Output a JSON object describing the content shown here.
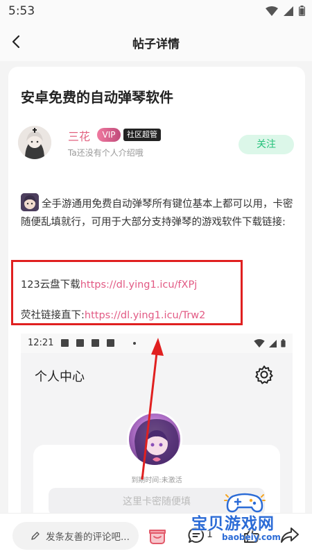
{
  "status_bar": {
    "time": "5:53"
  },
  "nav": {
    "title": "帖子详情"
  },
  "post": {
    "title": "安卓免费的自动弹琴软件",
    "author": {
      "name": "三花",
      "vip": "VIP",
      "role": "社区超管",
      "bio": "Ta还没有个人介绍哦"
    },
    "follow_label": "关注",
    "body": "全手游通用免费自动弹琴所有键位基本上都可以用，卡密随便乱填就行，可用于大部分支持弹琴的游戏软件下载链接:",
    "link1": {
      "label": "123云盘下载",
      "url": "https://dl.ying1.icu/fXPj"
    },
    "link2": {
      "label": "荧社链接直下:",
      "url": "https://dl.ying1.icu/Trw2"
    }
  },
  "embedded_screenshot": {
    "time": "12:21",
    "title": "个人中心",
    "expire": "到期时间:未激活",
    "input_placeholder": "这里卡密随便填"
  },
  "bottom_bar": {
    "comment_placeholder": "发条友善的评论吧...",
    "comment_count": "1"
  },
  "watermark": {
    "name": "宝贝游戏网",
    "url": "baobeiy.com"
  },
  "colors": {
    "accent_pink": "#e25a84",
    "follow_green": "#26c27b",
    "highlight_red": "#e02020"
  }
}
